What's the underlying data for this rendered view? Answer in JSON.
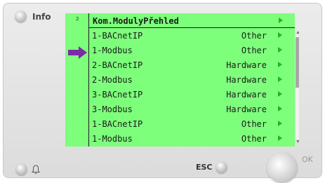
{
  "device": {
    "info_label": "Info",
    "esc_label": "ESC",
    "ok_label": "OK"
  },
  "screen": {
    "page_number": "2",
    "title": "Kom.ModulyPřehled",
    "rows": [
      {
        "name": "1-BACnetIP",
        "type": "Other"
      },
      {
        "name": "1-Modbus",
        "type": "Other"
      },
      {
        "name": "2-BACnetIP",
        "type": "Hardware"
      },
      {
        "name": "2-Modbus",
        "type": "Hardware"
      },
      {
        "name": "3-BACnetIP",
        "type": "Hardware"
      },
      {
        "name": "3-Modbus",
        "type": "Hardware"
      },
      {
        "name": "1-BACnetIP",
        "type": "Other"
      },
      {
        "name": "1-Modbus",
        "type": "Other"
      }
    ],
    "selected_row": 2,
    "colors": {
      "background": "#7dff7b",
      "arrow": "#22b422",
      "pointer": "#7d2aa8"
    }
  }
}
